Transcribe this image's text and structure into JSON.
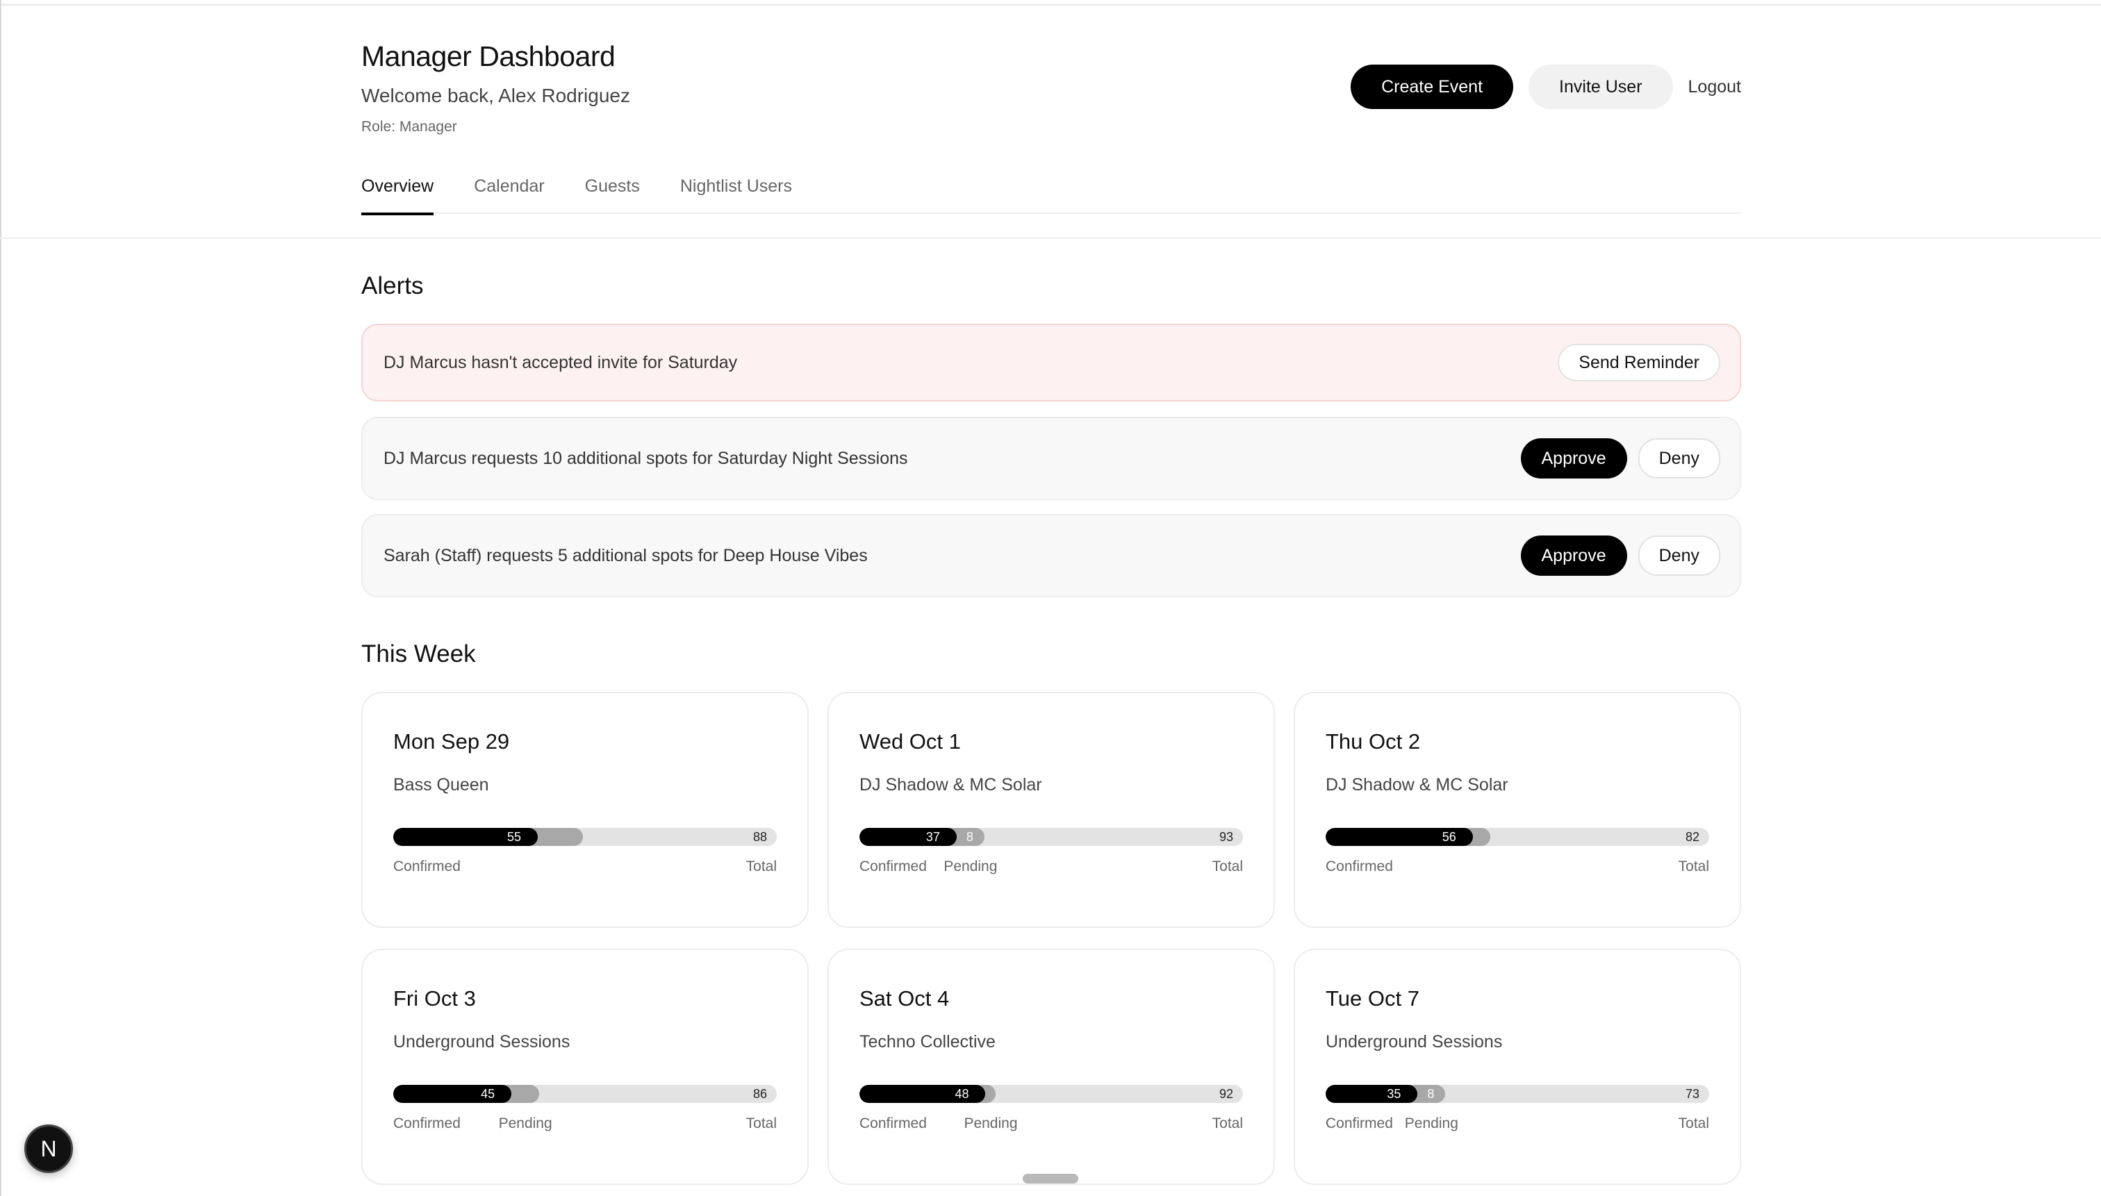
{
  "header": {
    "title": "Manager Dashboard",
    "welcome": "Welcome back, Alex Rodriguez",
    "role": "Role: Manager",
    "create_event_label": "Create Event",
    "invite_user_label": "Invite User",
    "logout_label": "Logout"
  },
  "tabs": [
    {
      "label": "Overview",
      "active": true
    },
    {
      "label": "Calendar",
      "active": false
    },
    {
      "label": "Guests",
      "active": false
    },
    {
      "label": "Nightlist Users",
      "active": false
    }
  ],
  "alerts": {
    "title": "Alerts",
    "items": [
      {
        "text": "DJ Marcus hasn't accepted invite for Saturday",
        "type": "warning",
        "reminder_label": "Send Reminder"
      },
      {
        "text": "DJ Marcus requests 10 additional spots for Saturday Night Sessions",
        "type": "request",
        "approve_label": "Approve",
        "deny_label": "Deny"
      },
      {
        "text": "Sarah (Staff) requests 5 additional spots for Deep House Vibes",
        "type": "request",
        "approve_label": "Approve",
        "deny_label": "Deny"
      }
    ]
  },
  "week": {
    "title": "This Week",
    "labels": {
      "confirmed": "Confirmed",
      "pending": "Pending",
      "total": "Total"
    },
    "events": [
      {
        "date": "Mon Sep 29",
        "artist": "Bass Queen",
        "confirmed": 55,
        "pending": 13,
        "pending_label": "",
        "show_pending_label": false,
        "total": 88
      },
      {
        "date": "Wed Oct 1",
        "artist": "DJ Shadow & MC Solar",
        "confirmed": 37,
        "pending": 8,
        "pending_label": "8",
        "show_pending_label": true,
        "total": 93
      },
      {
        "date": "Thu Oct 2",
        "artist": "DJ Shadow & MC Solar",
        "confirmed": 56,
        "pending": 5,
        "pending_label": "",
        "show_pending_label": false,
        "total": 82
      },
      {
        "date": "Fri Oct 3",
        "artist": "Underground Sessions",
        "confirmed": 45,
        "pending": 8,
        "pending_label": "",
        "show_pending_label": true,
        "total": 86
      },
      {
        "date": "Sat Oct 4",
        "artist": "Techno Collective",
        "confirmed": 48,
        "pending": 3,
        "pending_label": "",
        "show_pending_label": true,
        "total": 92
      },
      {
        "date": "Tue Oct 7",
        "artist": "Underground Sessions",
        "confirmed": 35,
        "pending": 8,
        "pending_label": "8",
        "show_pending_label": true,
        "total": 73
      }
    ]
  },
  "dev_badge": {
    "letter": "N"
  }
}
